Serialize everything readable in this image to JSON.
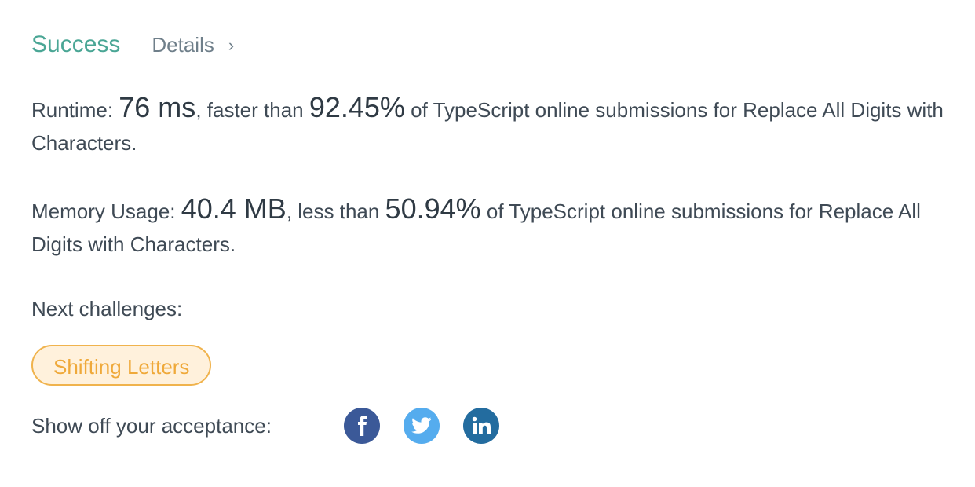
{
  "header": {
    "status": "Success",
    "details_label": "Details",
    "details_chevron": "›"
  },
  "runtime": {
    "label": "Runtime: ",
    "value": "76 ms",
    "comparison": ", faster than ",
    "percent": "92.45%",
    "suffix": " of TypeScript online submissions for Replace All Digits with Characters."
  },
  "memory": {
    "label": "Memory Usage: ",
    "value": "40.4 MB",
    "comparison": ", less than ",
    "percent": "50.94%",
    "suffix": " of TypeScript online submissions for Replace All Digits with Characters."
  },
  "next": {
    "label": "Next challenges:",
    "challenges": [
      "Shifting Letters"
    ]
  },
  "share": {
    "label": "Show off your acceptance:",
    "icons": [
      "facebook-icon",
      "twitter-icon",
      "linkedin-icon"
    ]
  },
  "colors": {
    "success": "#4aa695",
    "tag_border": "#f0b34d",
    "tag_bg": "#fff1dc",
    "tag_text": "#efa93a",
    "facebook": "#3b5998",
    "twitter": "#55acee",
    "linkedin": "#236c9f"
  }
}
